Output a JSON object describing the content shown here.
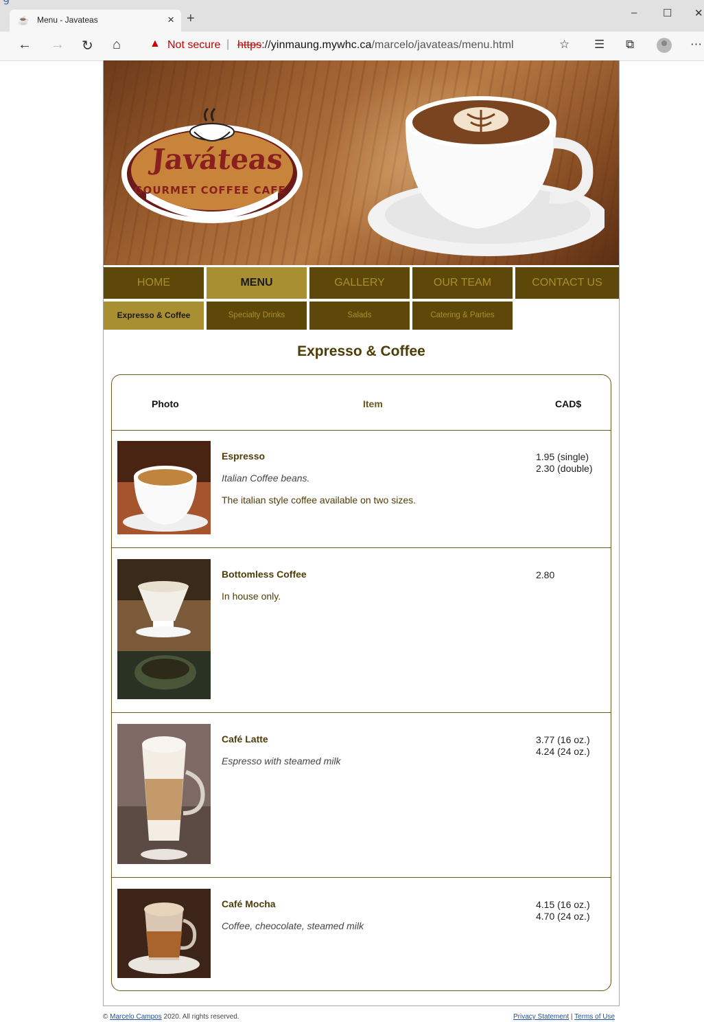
{
  "browser": {
    "top_fragment": "g",
    "tab_title": "Menu - Javateas",
    "tab_close": "×",
    "new_tab": "+",
    "security_warning": "Not secure",
    "url_scheme": "https",
    "url_host_sep": "://",
    "url_host": "yinmaung.mywhc.ca",
    "url_path": "/marcelo/javateas/menu.html",
    "window_controls": {
      "minimize": "–",
      "maximize": "☐",
      "close": "✕"
    }
  },
  "site": {
    "logo_word": "Javáteas",
    "logo_tagline": "GOURMET COFFEE CAFE",
    "nav": [
      {
        "label": "HOME",
        "active": false
      },
      {
        "label": "MENU",
        "active": true
      },
      {
        "label": "GALLERY",
        "active": false
      },
      {
        "label": "OUR TEAM",
        "active": false
      },
      {
        "label": "CONTACT US",
        "active": false
      }
    ],
    "subnav": [
      {
        "label": "Expresso & Coffee",
        "active": true
      },
      {
        "label": "Specialty Drinks",
        "active": false
      },
      {
        "label": "Salads",
        "active": false
      },
      {
        "label": "Catering & Parties",
        "active": false
      }
    ]
  },
  "menu": {
    "title": "Expresso & Coffee",
    "headers": {
      "photo": "Photo",
      "item": "Item",
      "price": "CAD$"
    },
    "items": [
      {
        "name": "Espresso",
        "subtitle": "Italian Coffee beans.",
        "description": "The italian style coffee available on two sizes.",
        "price_1": "1.95 (single)",
        "price_2": "2.30 (double)"
      },
      {
        "name": "Bottomless Coffee",
        "description": "In house only.",
        "price_1": "2.80"
      },
      {
        "name": "Café Latte",
        "subtitle": "Espresso with steamed milk",
        "price_1": "3.77 (16 oz.)",
        "price_2": "4.24 (24 oz.)"
      },
      {
        "name": "Café Mocha",
        "subtitle": "Coffee, cheocolate, steamed milk",
        "price_1": "4.15 (16 oz.)",
        "price_2": "4.70 (24 oz.)"
      }
    ]
  },
  "footer": {
    "copyright_prefix": "© ",
    "author": "Marcelo Campos",
    "copyright_suffix": " 2020. All rights reserved.",
    "privacy": "Privacy Statement",
    "separator": " | ",
    "terms": "Terms of Use"
  },
  "colors": {
    "nav_bg": "#5e4809",
    "nav_active_bg": "#a89032",
    "nav_text": "#a88e2d",
    "title_color": "#4e3c07",
    "warning_red": "#c80000"
  }
}
